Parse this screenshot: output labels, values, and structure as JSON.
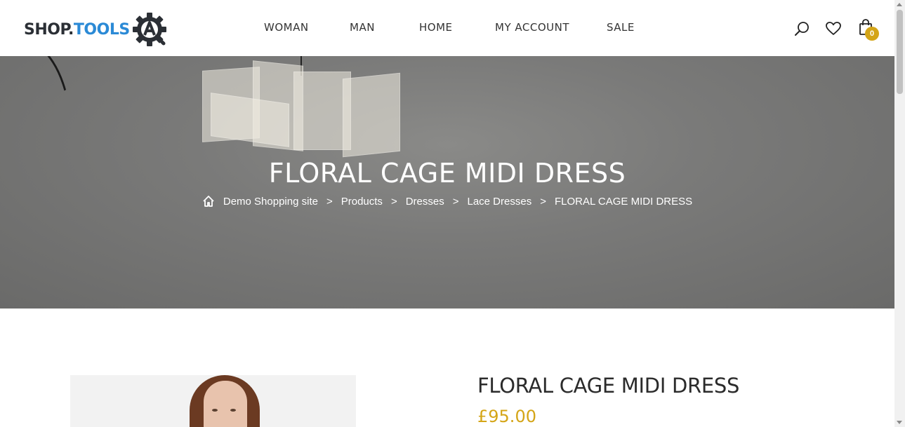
{
  "brand": {
    "part1": "SHOP.",
    "part2": "TOOLS",
    "colors": {
      "dark": "#2b2f35",
      "blue": "#2b8ad6",
      "accent": "#d4a517"
    }
  },
  "nav": {
    "items": [
      {
        "label": "WOMAN"
      },
      {
        "label": "MAN"
      },
      {
        "label": "HOME"
      },
      {
        "label": "MY ACCOUNT"
      },
      {
        "label": "SALE"
      }
    ]
  },
  "header_icons": {
    "search": "search-icon",
    "wishlist": "heart-icon",
    "cart": "shopping-bag-icon",
    "cart_count": "0"
  },
  "hero": {
    "title": "FLORAL CAGE MIDI DRESS",
    "breadcrumbs": [
      {
        "label": "Demo Shopping site"
      },
      {
        "label": "Products"
      },
      {
        "label": "Dresses"
      },
      {
        "label": "Lace Dresses"
      },
      {
        "label": "FLORAL CAGE MIDI DRESS"
      }
    ],
    "separator": ">"
  },
  "product": {
    "title": "FLORAL CAGE MIDI DRESS",
    "price": "£95.00"
  }
}
